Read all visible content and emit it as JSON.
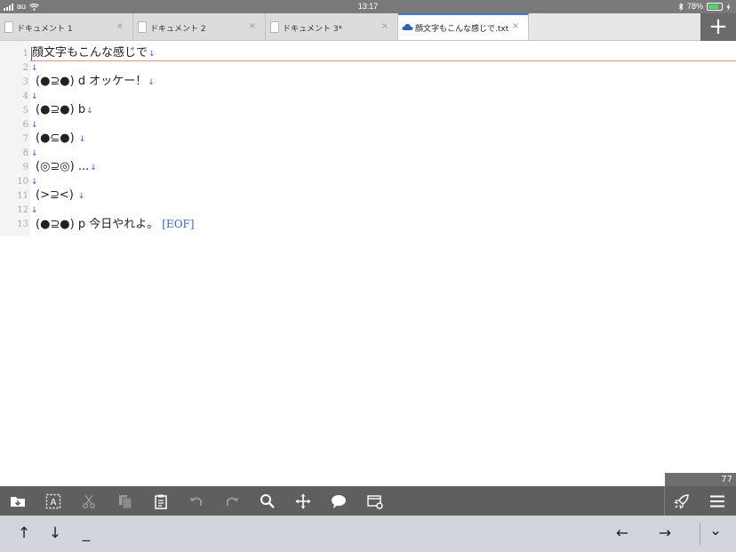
{
  "status": {
    "carrier": "au",
    "time": "13:17",
    "battery": "78%"
  },
  "tabs": [
    {
      "label": "ドキュメント 1",
      "icon": "document-icon",
      "active": false
    },
    {
      "label": "ドキュメント 2",
      "icon": "document-icon",
      "active": false
    },
    {
      "label": "ドキュメント 3*",
      "icon": "document-icon",
      "active": false
    },
    {
      "label": "顔文字もこんな感じで.txt",
      "icon": "cloud-icon",
      "active": true
    }
  ],
  "close_glyph": "×",
  "add_glyph": "+",
  "editor": {
    "lines": [
      {
        "num": "1",
        "text": "顔文字もこんな感じで",
        "ret": "↓"
      },
      {
        "num": "2",
        "text": "",
        "ret": "↓"
      },
      {
        "num": "3",
        "text": "(●⊇●) d オッケー！",
        "ret": "↓"
      },
      {
        "num": "4",
        "text": "",
        "ret": "↓"
      },
      {
        "num": "5",
        "text": "(●⊇●) b",
        "ret": "↓"
      },
      {
        "num": "6",
        "text": "",
        "ret": "↓"
      },
      {
        "num": "7",
        "text": "(●⊆●) ",
        "ret": "↓"
      },
      {
        "num": "8",
        "text": "",
        "ret": "↓"
      },
      {
        "num": "9",
        "text": "(◎⊇◎) ...",
        "ret": "↓"
      },
      {
        "num": "10",
        "text": "",
        "ret": "↓"
      },
      {
        "num": "11",
        "text": "(>⊇<) ",
        "ret": "↓"
      },
      {
        "num": "12",
        "text": "",
        "ret": "↓"
      },
      {
        "num": "13",
        "text": "(●⊇●) p 今日やれよ。",
        "ret": "",
        "eof": "[EOF]"
      }
    ]
  },
  "char_count": "77",
  "toolbar": {
    "items": [
      "folder-import-icon",
      "select-all-icon",
      "cut-icon",
      "copy-icon",
      "paste-icon",
      "undo-icon",
      "redo-icon",
      "search-icon",
      "move-icon",
      "comment-icon",
      "window-settings-icon"
    ],
    "right_items": [
      "rocket-icon",
      "menu-icon"
    ]
  },
  "accessory": {
    "up": "↑",
    "down": "↓",
    "underscore": "_",
    "left": "←",
    "right": "→",
    "dismiss": "⌄"
  },
  "colors": {
    "accent": "#3e7ad6",
    "return_mark": "#3d5bd9",
    "toolbar": "#5f5f5f"
  }
}
